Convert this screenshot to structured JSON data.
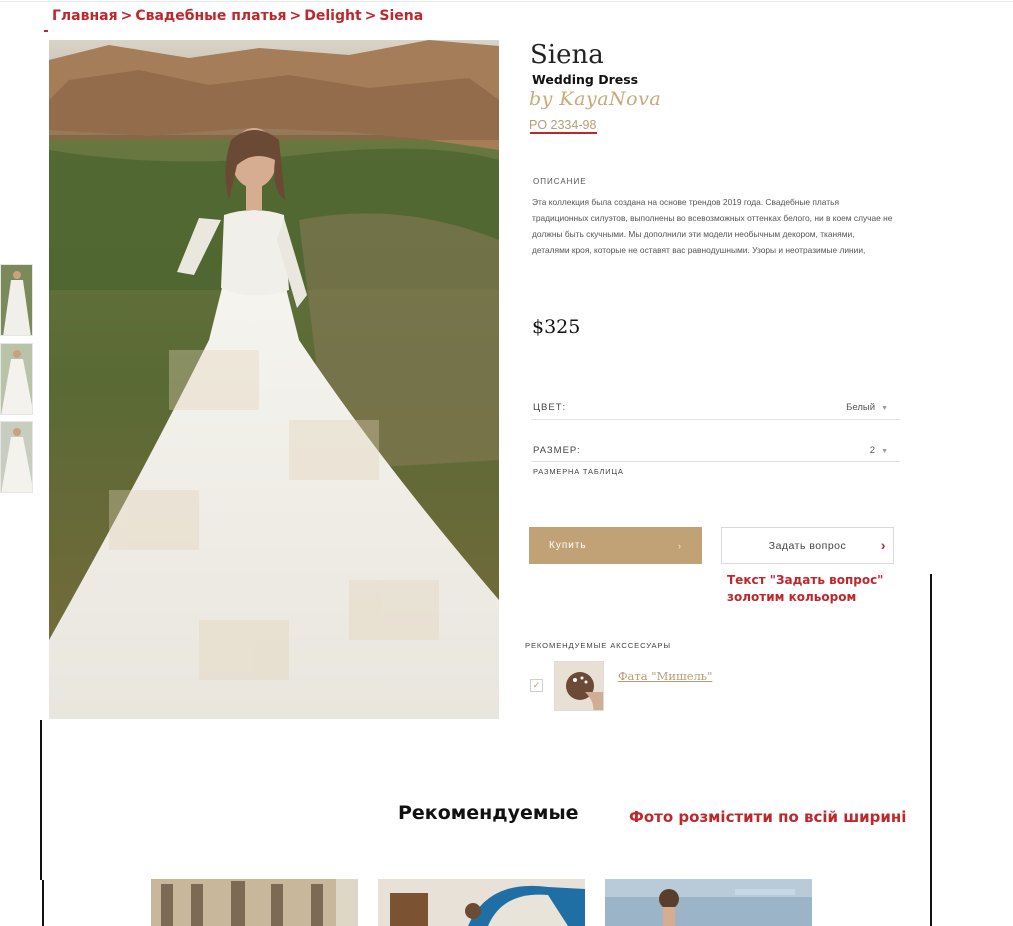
{
  "breadcrumb": {
    "items": [
      "Главная",
      "Свадебные платья",
      "Delight",
      "Siena"
    ],
    "separator": ">"
  },
  "product": {
    "title": "Siena",
    "subtitle": "Wedding Dress",
    "brand": "by KayaNova",
    "sku": "PO 2334-98",
    "description_heading": "ОПИСАНИЕ",
    "description": "Эта коллекция была создана на основе трендов 2019 года. Свадебные платья традиционных силуэтов, выполнены во всевозможных оттенках белого, ни в коем случае не должны быть скучными. Мы дополнили эти модели необычным декором, тканями, деталями кроя, которые не оставят вас равнодушными. Узоры и неотразимые линии,",
    "price": "$325",
    "color": {
      "label": "ЦВЕТ:",
      "value": "Белый"
    },
    "size": {
      "label": "РАЗМЕР:",
      "value": "2"
    },
    "size_table": "РАЗМЕРНА ТАБЛИЦА",
    "buy_button": "Купить",
    "buy_arrow": "›",
    "ask_button": "Задать вопрос",
    "ask_chevron": "›"
  },
  "notes": {
    "ask_button_color": "Текст \"Задать вопрос\" золотим кольором",
    "recommended_width": "Фото розмістити по всій ширині"
  },
  "accessories": {
    "heading": "РЕКОМЕНДУЕМЫЕ АКССЕСУАРЫ",
    "items": [
      {
        "name": "Фата \"Мишель\"",
        "checked": true,
        "check_glyph": "✓"
      }
    ]
  },
  "recommended": {
    "heading": "Рекомендуемые"
  },
  "colors": {
    "gold": "#c0a276",
    "gold_text": "#b79c78",
    "annotation_red": "#c0272d"
  },
  "icons": {
    "caret": "caret-down-icon",
    "chevron": "chevron-right-icon",
    "check": "check-icon"
  }
}
